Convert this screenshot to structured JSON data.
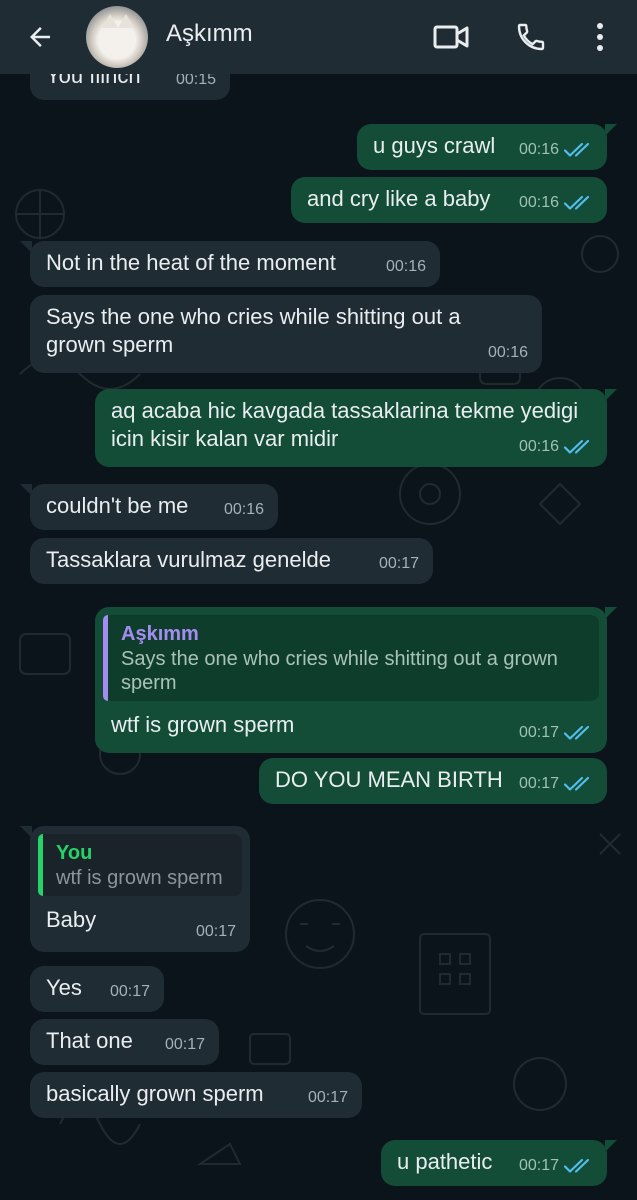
{
  "header": {
    "contact_name": "Aşkımm",
    "icons": [
      "back-arrow-icon",
      "video-call-icon",
      "phone-icon",
      "more-vert-icon"
    ]
  },
  "colors": {
    "background": "#0b141a",
    "header": "#1f2c34",
    "incoming_bubble": "#1f2c34",
    "outgoing_bubble": "#134d37",
    "read_ticks": "#53bdeb",
    "quote_bar_contact": "#a68cf2",
    "quote_bar_you": "#25d366"
  },
  "messages": [
    {
      "dir": "in",
      "text": "You flinch",
      "time": "00:15"
    },
    {
      "dir": "out",
      "text": "u guys crawl",
      "time": "00:16"
    },
    {
      "dir": "out",
      "text": "and cry like a baby",
      "time": "00:16"
    },
    {
      "dir": "in",
      "text": "Not in the heat of the moment",
      "time": "00:16"
    },
    {
      "dir": "in",
      "text": "Says the one who cries while shitting out a grown sperm",
      "time": "00:16"
    },
    {
      "dir": "out",
      "text": "aq acaba hic kavgada tassaklarina tekme yedigi icin kisir kalan var midir",
      "time": "00:16"
    },
    {
      "dir": "in",
      "text": "couldn't be me",
      "time": "00:16"
    },
    {
      "dir": "in",
      "text": "Tassaklara vurulmaz genelde",
      "time": "00:17"
    },
    {
      "dir": "out",
      "text": "wtf is grown sperm",
      "time": "00:17",
      "quote": {
        "name": "Aşkımm",
        "text": "Says the one who cries while shitting out a grown sperm"
      }
    },
    {
      "dir": "out",
      "text": "DO YOU MEAN BIRTH",
      "time": "00:17"
    },
    {
      "dir": "in",
      "text": "Baby",
      "time": "00:17",
      "quote": {
        "name": "You",
        "text": "wtf is grown sperm"
      }
    },
    {
      "dir": "in",
      "text": "Yes",
      "time": "00:17"
    },
    {
      "dir": "in",
      "text": "That one",
      "time": "00:17"
    },
    {
      "dir": "in",
      "text": "basically grown sperm",
      "time": "00:17"
    },
    {
      "dir": "out",
      "text": "u pathetic",
      "time": "00:17"
    }
  ]
}
